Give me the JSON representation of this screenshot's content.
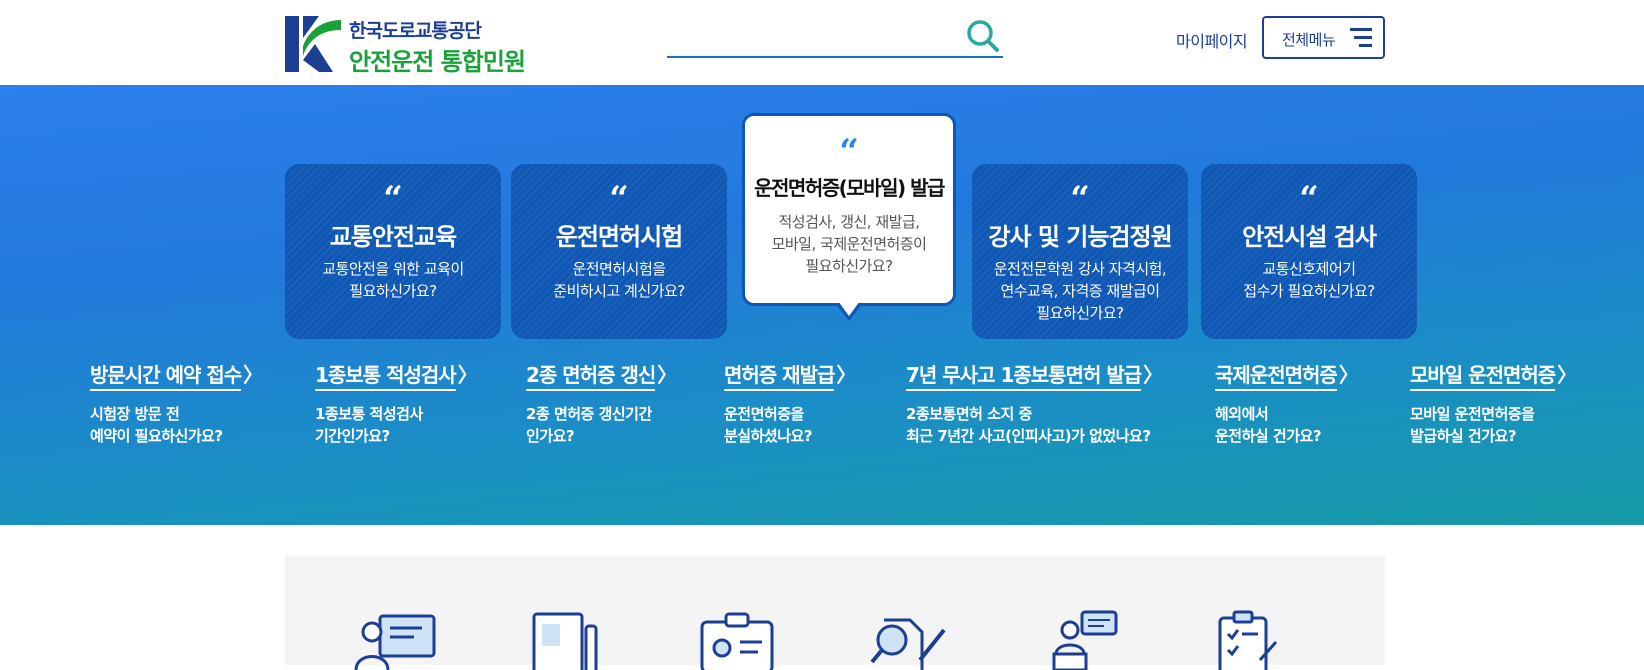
{
  "header": {
    "org_name": "한국도로교통공단",
    "site_title": "안전운전 통합민원",
    "search_placeholder": "",
    "mypage_label": "마이페이지",
    "allmenu_label": "전체메뉴"
  },
  "colors": {
    "brand_navy": "#1c3f94",
    "brand_green": "#1aa13a",
    "card_blue": "#0f57b4",
    "hero_top": "#2b80ec",
    "hero_bottom": "#159aa6"
  },
  "cards": [
    {
      "title": "교통안전교육",
      "line1": "교통안전을 위한 교육이",
      "line2": "필요하신가요?",
      "line3": ""
    },
    {
      "title": "운전면허시험",
      "line1": "운전면허시험을",
      "line2": "준비하시고 계신가요?",
      "line3": ""
    },
    {
      "title": "강사 및 기능검정원",
      "line1": "운전전문학원 강사 자격시험,",
      "line2": "연수교육, 자격증 재발급이",
      "line3": "필요하신가요?"
    },
    {
      "title": "안전시설 검사",
      "line1": "교통신호제어기",
      "line2": "접수가 필요하신가요?",
      "line3": ""
    }
  ],
  "active_card": {
    "title": "운전면허증(모바일) 발급",
    "line1": "적성검사, 갱신, 재발급,",
    "line2": "모바일, 국제운전면허증이",
    "line3": "필요하신가요?"
  },
  "quote_mark": "“",
  "arrow_glyph": "〉",
  "links": [
    {
      "title": "방문시간 예약 접수",
      "line1": "시험장 방문 전",
      "line2": "예약이 필요하신가요?"
    },
    {
      "title": "1종보통 적성검사",
      "line1": "1종보통 적성검사",
      "line2": "기간인가요?"
    },
    {
      "title": "2종 면허증 갱신",
      "line1": "2종 면허증 갱신기간",
      "line2": "인가요?"
    },
    {
      "title": "면허증 재발급",
      "line1": "운전면허증을",
      "line2": "분실하셨나요?"
    },
    {
      "title": "7년 무사고 1종보통면허 발급",
      "line1": "2종보통면허 소지 중",
      "line2": "최근 7년간 사고(인피사고)가 없었나요?"
    },
    {
      "title": "국제운전면허증",
      "line1": "해외에서",
      "line2": "운전하실 건가요?"
    },
    {
      "title": "모바일 운전면허증",
      "line1": "모바일 운전면허증을",
      "line2": "발급하실 건가요?"
    }
  ],
  "quick_icons": [
    "education-icon",
    "license-book-icon",
    "id-card-icon",
    "inspection-icon",
    "instructor-icon",
    "checklist-icon"
  ]
}
